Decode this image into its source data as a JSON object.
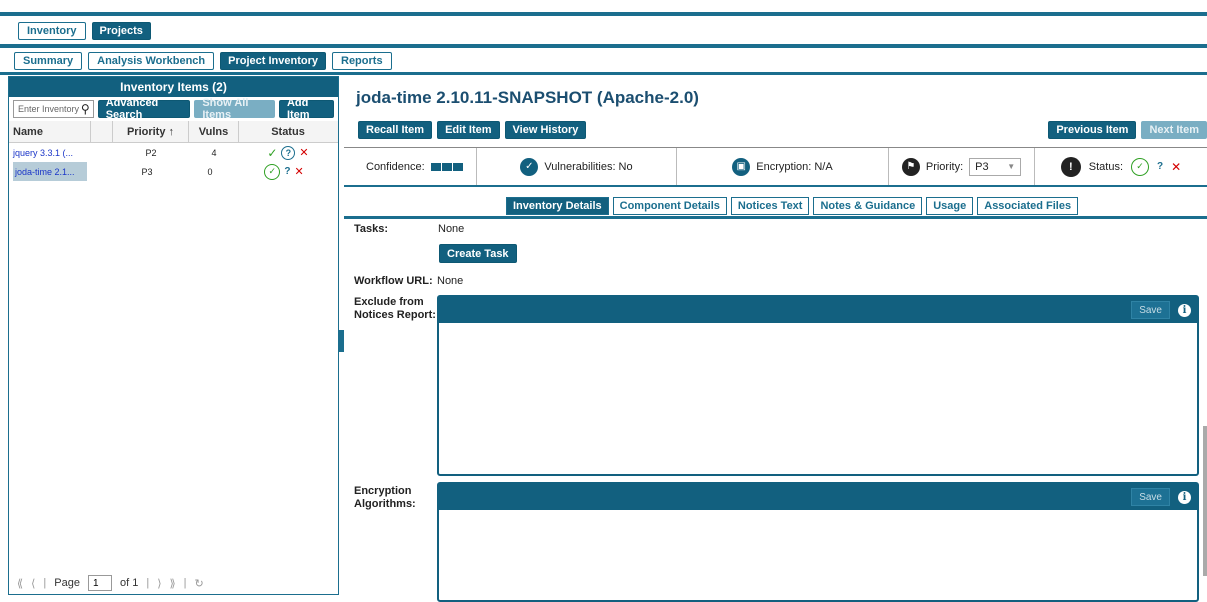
{
  "top_tabs": [
    {
      "label": "Inventory",
      "active": false
    },
    {
      "label": "Projects",
      "active": true
    }
  ],
  "sub_tabs": [
    {
      "label": "Summary",
      "active": false
    },
    {
      "label": "Analysis Workbench",
      "active": false
    },
    {
      "label": "Project Inventory",
      "active": true
    },
    {
      "label": "Reports",
      "active": false
    }
  ],
  "inventory_panel": {
    "title": "Inventory Items (2)",
    "search_placeholder": "Enter Inventory",
    "advanced_search": "Advanced Search",
    "show_all": "Show All Items",
    "add_item": "Add Item",
    "columns": [
      "Name",
      "Priority ↑",
      "Vulns",
      "Status"
    ],
    "rows": [
      {
        "name": "jquery 3.3.1 (...",
        "priority": "P2",
        "vulns": "4",
        "selected": false
      },
      {
        "name": "joda-time 2.1...",
        "priority": "P3",
        "vulns": "0",
        "selected": true
      }
    ],
    "pager": {
      "page_label": "Page",
      "page_value": "1",
      "of_label": "of 1"
    }
  },
  "item": {
    "title": "joda-time 2.10.11-SNAPSHOT (Apache-2.0)",
    "actions": [
      "Recall Item",
      "Edit Item",
      "View History"
    ],
    "previous": "Previous Item",
    "next": "Next Item"
  },
  "info_bar": {
    "confidence_label": "Confidence:",
    "vulnerabilities": "Vulnerabilities: No",
    "encryption": "Encryption: N/A",
    "priority_label": "Priority:",
    "priority_value": "P3",
    "status_label": "Status:",
    "status_q": "?"
  },
  "detail_tabs": [
    {
      "label": "Inventory Details",
      "active": true
    },
    {
      "label": "Component Details",
      "active": false
    },
    {
      "label": "Notices Text",
      "active": false
    },
    {
      "label": "Notes & Guidance",
      "active": false
    },
    {
      "label": "Usage",
      "active": false
    },
    {
      "label": "Associated Files",
      "active": false
    }
  ],
  "form": {
    "tasks_label": "Tasks:",
    "tasks_value": "None",
    "create_task": "Create Task",
    "workflow_label": "Workflow URL:",
    "workflow_value": "None",
    "exclude_label_1": "Exclude from",
    "exclude_label_2": "Notices Report:",
    "encryption_label_1": "Encryption",
    "encryption_label_2": "Algorithms:",
    "save": "Save"
  },
  "colors": {
    "primary": "#12607f",
    "accent_blue": "#1b6e8e",
    "success": "#2fa023",
    "danger": "#d40000"
  }
}
